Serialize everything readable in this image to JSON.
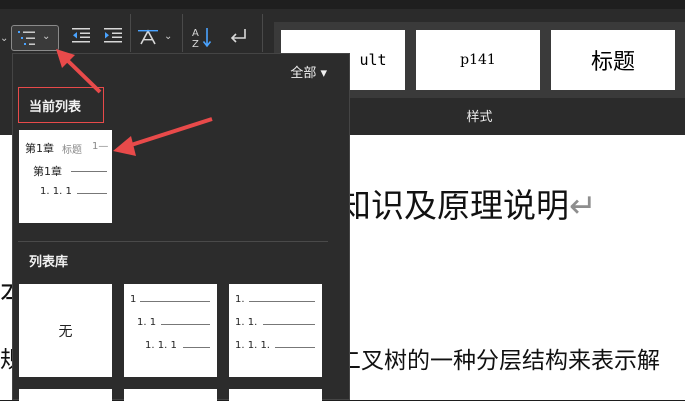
{
  "ribbon": {
    "list_button_icon": "multilevel-list-icon",
    "chevron": "⌄",
    "decrease_indent_icon": "decrease-indent-icon",
    "increase_indent_icon": "increase-indent-icon",
    "char_spacing_icon": "character-spacing-icon",
    "sort_icon": "sort-az-icon",
    "line_break_icon": "line-break-icon",
    "styles": [
      "ult",
      "p141",
      "标题"
    ],
    "styles_label": "样式"
  },
  "document": {
    "heading_fragment": "知识及原理说明",
    "left_fragment_1": "本",
    "left_fragment_2": "规",
    "body_fragment": "二叉树的一种分层结构来表示解",
    "pilcrow": "↵"
  },
  "dropdown": {
    "filter_label": "全部",
    "filter_chevron": "▾",
    "current_list_label": "当前列表",
    "current_list": {
      "line1": "第1章",
      "line1_sub": "标题",
      "line1_tail": "1—",
      "line2": "第1章",
      "line3": "1. 1. 1"
    },
    "library_label": "列表库",
    "library": {
      "none_label": "无",
      "numbered": {
        "l1": "1",
        "l2": "1. 1",
        "l3": "1. 1. 1"
      },
      "dotted": {
        "l1": "1.",
        "l2": "1. 1.",
        "l3": "1. 1. 1."
      }
    }
  },
  "colors": {
    "ribbon_bg": "#2b2b2b",
    "dropdown_bg": "#2c2c2c",
    "annotation_red": "#e84a4a"
  }
}
